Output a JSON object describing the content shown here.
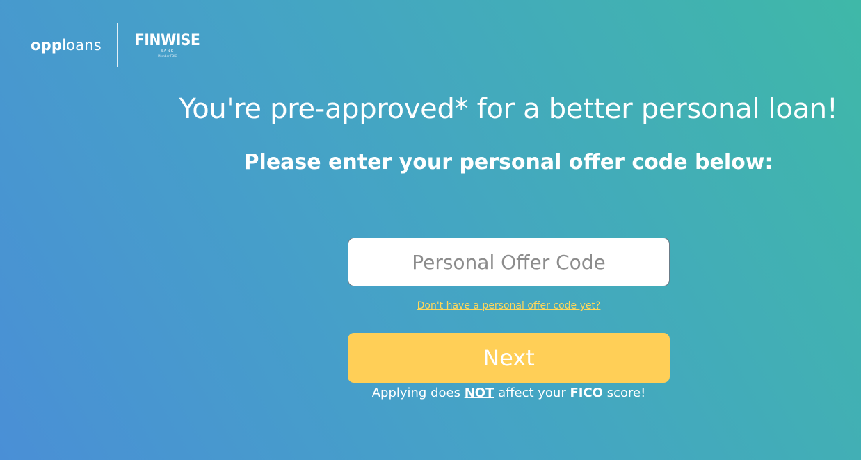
{
  "header": {
    "opp_logo_bold": "opp",
    "opp_logo_light": "loans",
    "partner_name": "FINWISE",
    "partner_sub": "BANK",
    "partner_member": "Member FDIC"
  },
  "main": {
    "headline": "You're pre-approved* for a better personal loan!",
    "subhead": "Please enter your personal offer code below:",
    "offer_input": {
      "value": "",
      "placeholder": "Personal Offer Code"
    },
    "no_code_link": "Don't have a personal offer code yet?",
    "next_label": "Next",
    "fico_note": {
      "part1": "Applying does ",
      "emphasis_not": "NOT",
      "part2": " affect your ",
      "emphasis_fico": "FICO",
      "part3": " score!"
    }
  },
  "colors": {
    "gradient_start": "#4a8fd6",
    "gradient_end": "#3fb8a8",
    "accent_yellow": "#ffcf57",
    "link_yellow": "#ffd75a"
  }
}
